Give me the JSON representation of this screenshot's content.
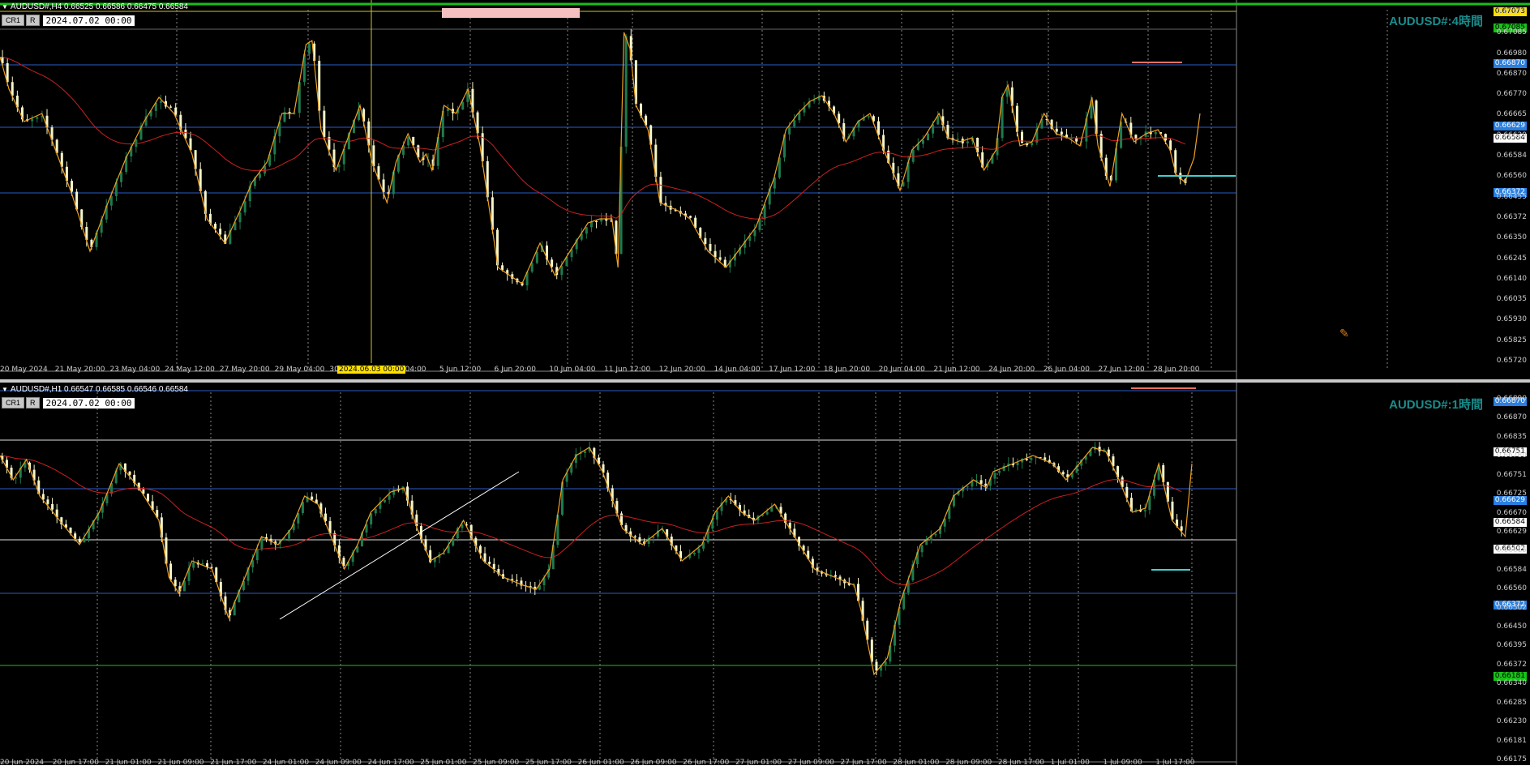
{
  "colors": {
    "bull": "#1e7b4e",
    "bear": "#f5f5c8",
    "zigzag": "#f0a020",
    "ma": "#cc2020",
    "blue": "#2a5cc8",
    "white": "#e0e0e0",
    "cyan": "#40d0d0",
    "salmon": "#ff7060",
    "grid": "#888"
  },
  "pane1": {
    "header": "AUDUSD#,H4  0.66525 0.66586 0.66475 0.66584",
    "buttons": [
      "CR1",
      "R"
    ],
    "datetime": "2024.07.02 00:00",
    "title": "AUDUSD#:4時間",
    "cursor_time": "2024.06.03 00:00",
    "price_axis": [
      "0.67073",
      "0.67085",
      "0.66980",
      "0.66870",
      "0.66770",
      "0.66665",
      "0.66629",
      "0.66584",
      "0.66560",
      "0.66455",
      "0.66372",
      "0.66350",
      "0.66245",
      "0.66140",
      "0.66035",
      "0.65930",
      "0.65825",
      "0.65720"
    ],
    "time_axis": [
      "20 May 2024",
      "21 May 20:00",
      "23 May 04:00",
      "24 May 12:00",
      "27 May 20:00",
      "29 May 04:00",
      "30 May 12:00",
      "4 Jun 04:00",
      "5 Jun 12:00",
      "6 Jun 20:00",
      "10 Jun 04:00",
      "11 Jun 12:00",
      "12 Jun 20:00",
      "14 Jun 04:00",
      "17 Jun 12:00",
      "18 Jun 20:00",
      "20 Jun 04:00",
      "21 Jun 12:00",
      "24 Jun 20:00",
      "26 Jun 04:00",
      "27 Jun 12:00",
      "28 Jun 20:00"
    ],
    "tags": [
      {
        "label": "0.67073",
        "bg": "#ffe000",
        "fg": "#000"
      },
      {
        "label": "0.67085",
        "bg": "#18c018",
        "fg": "#000"
      },
      {
        "label": "0.66870",
        "bg": "#2a7fe0",
        "fg": "#fff"
      },
      {
        "label": "0.66629",
        "bg": "#2a7fe0",
        "fg": "#fff"
      },
      {
        "label": "0.66584",
        "bg": "#ffffff",
        "fg": "#000"
      },
      {
        "label": "0.66372",
        "bg": "#2a7fe0",
        "fg": "#fff"
      }
    ]
  },
  "pane2": {
    "header": "AUDUSD#,H1  0.66547 0.66585 0.66546 0.66584",
    "buttons": [
      "CR1",
      "R"
    ],
    "datetime": "2024.07.02 00:00",
    "title": "AUDUSD#:1時間",
    "price_axis": [
      "0.66890",
      "0.66870",
      "0.66835",
      "0.66780",
      "0.66751",
      "0.66725",
      "0.66670",
      "0.66629",
      "0.66615",
      "0.66584",
      "0.66560",
      "0.66502",
      "0.66450",
      "0.66395",
      "0.66372",
      "0.66340",
      "0.66285",
      "0.66230",
      "0.66181",
      "0.66175"
    ],
    "time_axis": [
      "20 Jun 2024",
      "20 Jun 17:00",
      "21 Jun 01:00",
      "21 Jun 09:00",
      "21 Jun 17:00",
      "24 Jun 01:00",
      "24 Jun 09:00",
      "24 Jun 17:00",
      "25 Jun 01:00",
      "25 Jun 09:00",
      "25 Jun 17:00",
      "26 Jun 01:00",
      "26 Jun 09:00",
      "26 Jun 17:00",
      "27 Jun 01:00",
      "27 Jun 09:00",
      "27 Jun 17:00",
      "28 Jun 01:00",
      "28 Jun 09:00",
      "28 Jun 17:00",
      "1 Jul 01:00",
      "1 Jul 09:00",
      "1 Jul 17:00"
    ],
    "tags": [
      {
        "label": "0.66870",
        "bg": "#2a7fe0",
        "fg": "#fff"
      },
      {
        "label": "0.66751",
        "bg": "#ffffff",
        "fg": "#000"
      },
      {
        "label": "0.66629",
        "bg": "#2a7fe0",
        "fg": "#fff"
      },
      {
        "label": "0.66584",
        "bg": "#ffffff",
        "fg": "#000"
      },
      {
        "label": "0.66502",
        "bg": "#ffffff",
        "fg": "#000"
      },
      {
        "label": "0.66372",
        "bg": "#2a7fe0",
        "fg": "#fff"
      },
      {
        "label": "0.66181",
        "bg": "#18c018",
        "fg": "#000"
      }
    ]
  },
  "icons": {
    "object_tool": "pencil-cross-icon"
  }
}
